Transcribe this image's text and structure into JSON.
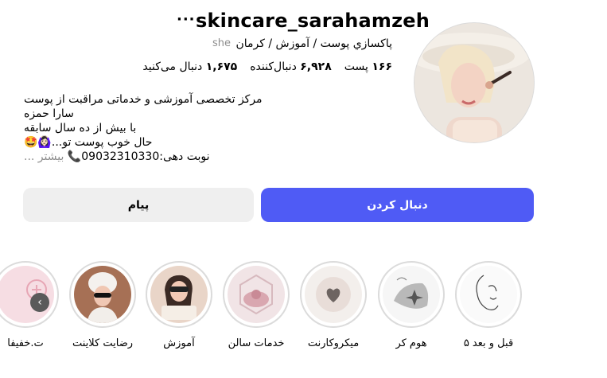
{
  "profile": {
    "username": "skincare_sarahamzeh",
    "more_label": "···",
    "category": "پاکسازي پوست / آموزش / کرمان",
    "pronoun": "she",
    "stats": {
      "posts_count": "۱۶۶",
      "posts_label": "پست",
      "followers_count": "۶,۹۲۸",
      "followers_label": "دنبال‌کننده",
      "following_count": "۱,۶۷۵",
      "following_label": "دنبال می‌کنید"
    },
    "bio": {
      "line1": "مرکز تخصصی آموزشی و خدماتی مراقبت از پوست",
      "line2": "سارا حمزه",
      "line3": "با بیش از ده سال سابقه",
      "line4": "حال خوب پوست تو...🙆🏻‍♀️🤩",
      "line5_text": "نوبت دهی:09032310330📞",
      "line5_more": "بیشتر ..."
    }
  },
  "actions": {
    "follow_label": "دنبال کردن",
    "message_label": "پیام"
  },
  "highlights": [
    {
      "label": "قبل و بعد ۵"
    },
    {
      "label": "هوم کر"
    },
    {
      "label": "میکروکارنت"
    },
    {
      "label": "خدمات سالن"
    },
    {
      "label": "آموزش"
    },
    {
      "label": "رضایت کلاینت"
    },
    {
      "label": "ت.خفیفا"
    }
  ],
  "colors": {
    "accent": "#4f5bf5",
    "secondary_button": "#efefef",
    "muted_text": "#8e8e8e"
  }
}
